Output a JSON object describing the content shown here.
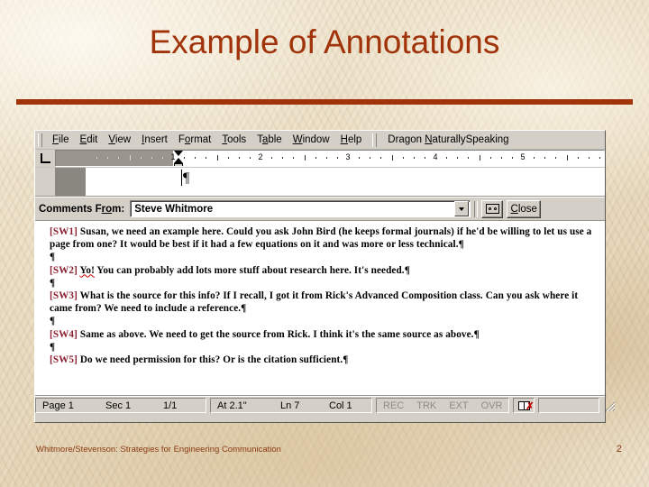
{
  "slide": {
    "title": "Example of Annotations",
    "title_color": "#a0330a",
    "footer_text": "Whitmore/Stevenson: Strategies for Engineering Communication",
    "page_number": "2"
  },
  "word_window": {
    "menubar": {
      "items": [
        {
          "label": "File",
          "mnemonic": "F"
        },
        {
          "label": "Edit",
          "mnemonic": "E"
        },
        {
          "label": "View",
          "mnemonic": "V"
        },
        {
          "label": "Insert",
          "mnemonic": "I"
        },
        {
          "label": "Format",
          "mnemonic": "o"
        },
        {
          "label": "Tools",
          "mnemonic": "T"
        },
        {
          "label": "Table",
          "mnemonic": "a"
        },
        {
          "label": "Window",
          "mnemonic": "W"
        },
        {
          "label": "Help",
          "mnemonic": "H"
        }
      ],
      "dragon_label_pre": "Dragon ",
      "dragon_label_mnemonic": "N",
      "dragon_label_post": "aturallySpeaking"
    },
    "ruler": {
      "tab_selector_icon": "left-tab-stop-icon",
      "numbers": [
        "1",
        "2",
        "3",
        "4",
        "5"
      ],
      "unit": "inches"
    },
    "comments_pane": {
      "label_pre": "Comments F",
      "label_mnemonic": "ro",
      "label_post": "m:",
      "author_value": "Steve Whitmore",
      "author_options": [
        "Steve Whitmore"
      ],
      "audio_button_icon": "cassette-tape-icon",
      "close_pre": "C",
      "close_mnemonic": "l",
      "close_post": "ose",
      "comments": [
        {
          "ref": "[SW1]",
          "text": "Susan, we need an example here. Could you ask John Bird (he keeps formal journals) if he'd be willing to let us use a page from one? It would be best if it had a few equations on it and was more or less technical."
        },
        {
          "ref": "[SW2]",
          "misspelled": "Yo!",
          "text": "You can probably add lots more stuff about research here. It's needed."
        },
        {
          "ref": "[SW3]",
          "text": "What is the source for this info? If I recall, I got it from Rick's Advanced Composition class. Can you ask where it came from? We need to include a reference."
        },
        {
          "ref": "[SW4]",
          "text": "Same as above. We need to get the source from Rick. I think it's the same source as above."
        },
        {
          "ref": "[SW5]",
          "text": "Do we need permission for this? Or is the citation sufficient."
        }
      ],
      "pilcrow": "¶"
    },
    "statusbar": {
      "page_label": "Page 1",
      "sec_label": "Sec 1",
      "pages_label": "1/1",
      "at_label": "At 2.1\"",
      "line_label": "Ln 7",
      "col_label": "Col 1",
      "rec_label": "REC",
      "trk_label": "TRK",
      "ext_label": "EXT",
      "ovr_label": "OVR",
      "spellcheck_icon": "spellcheck-book-error-icon"
    }
  }
}
